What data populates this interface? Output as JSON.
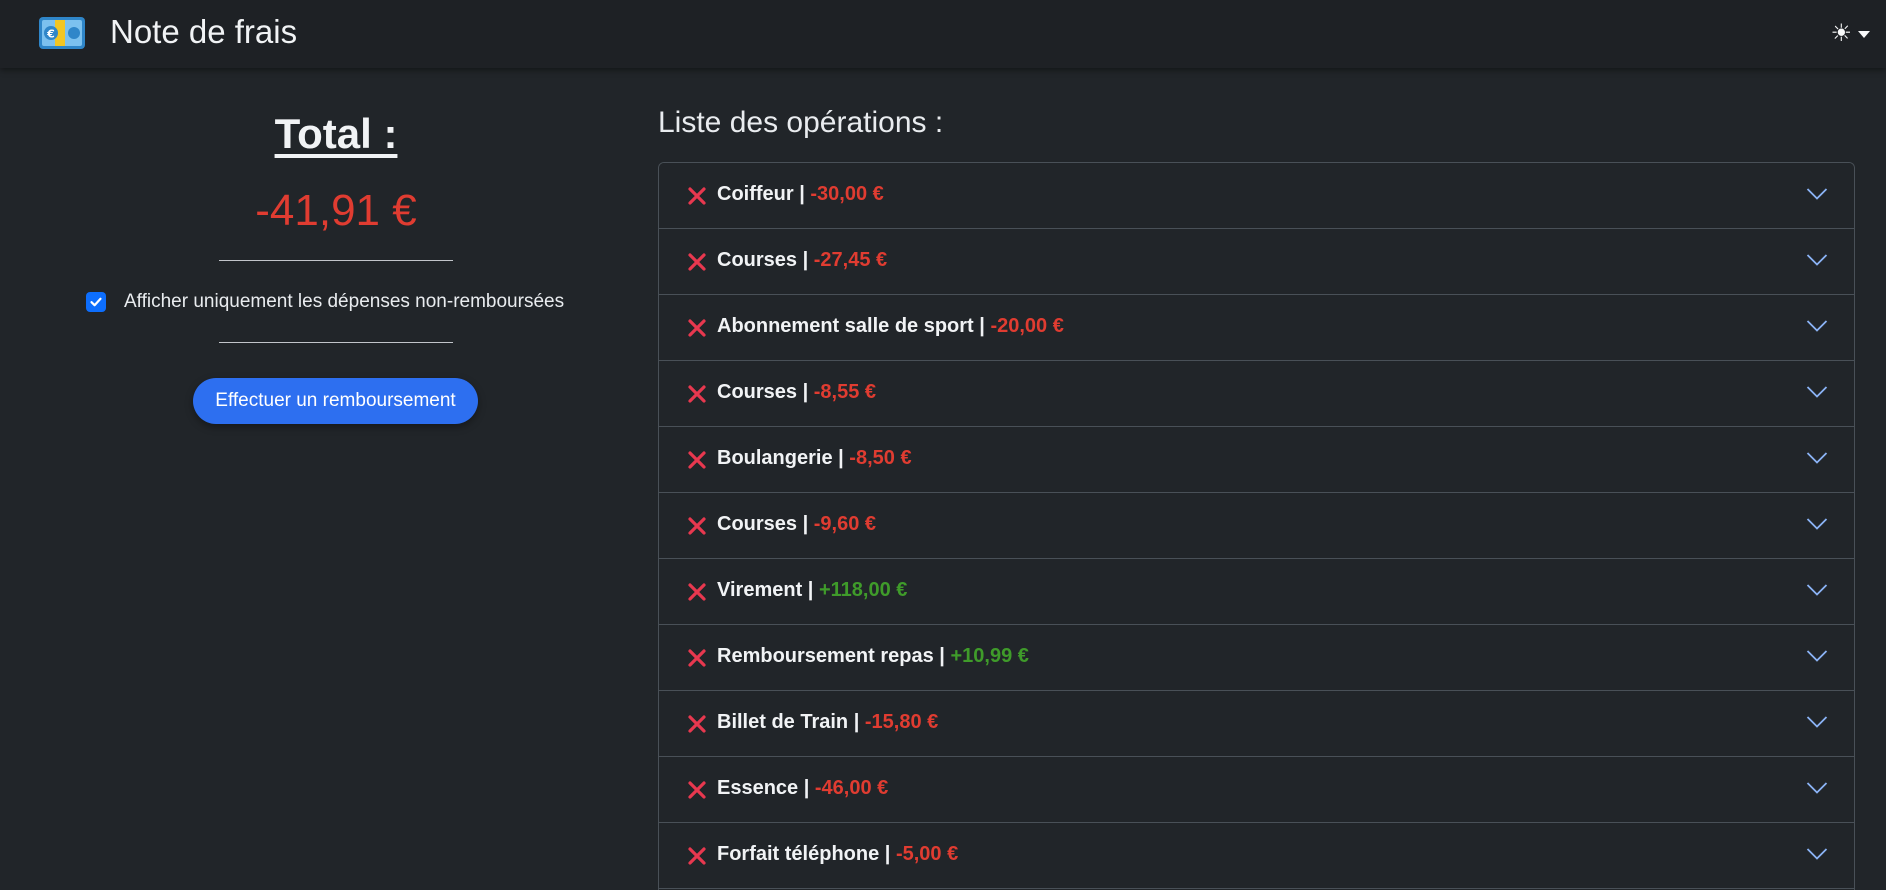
{
  "app": {
    "title": "Note de frais",
    "logo_icon": "banknote-euro-icon"
  },
  "theme_toggle": {
    "icon": "sun-icon"
  },
  "summary": {
    "total_label": "Total :",
    "total_amount": "-41,91 €",
    "filter_label": "Afficher uniquement les dépenses non-remboursées",
    "filter_checked": true,
    "refund_button_label": "Effectuer un remboursement"
  },
  "operations": {
    "title": "Liste des opérations :",
    "items": [
      {
        "label": "Coiffeur",
        "amount": "-30,00 €",
        "sign": "neg"
      },
      {
        "label": "Courses",
        "amount": "-27,45 €",
        "sign": "neg"
      },
      {
        "label": "Abonnement salle de sport",
        "amount": "-20,00 €",
        "sign": "neg"
      },
      {
        "label": "Courses",
        "amount": "-8,55 €",
        "sign": "neg"
      },
      {
        "label": "Boulangerie",
        "amount": "-8,50 €",
        "sign": "neg"
      },
      {
        "label": "Courses",
        "amount": "-9,60 €",
        "sign": "neg"
      },
      {
        "label": "Virement",
        "amount": "+118,00 €",
        "sign": "pos"
      },
      {
        "label": "Remboursement repas",
        "amount": "+10,99 €",
        "sign": "pos"
      },
      {
        "label": "Billet de Train",
        "amount": "-15,80 €",
        "sign": "neg"
      },
      {
        "label": "Essence",
        "amount": "-46,00 €",
        "sign": "neg"
      },
      {
        "label": "Forfait téléphone",
        "amount": "-5,00 €",
        "sign": "neg"
      }
    ]
  },
  "colors": {
    "background": "#212529",
    "negative": "#e03c31",
    "positive": "#3f9b2a",
    "accent": "#2d6ff0",
    "delete_icon": "#e8384f",
    "chevron": "#8bb3f5"
  }
}
